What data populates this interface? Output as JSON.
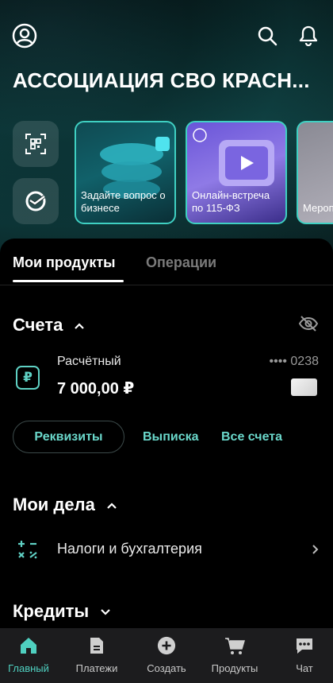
{
  "header": {
    "org_name": "АССОЦИАЦИЯ СВО КРАСН..."
  },
  "stories": [
    {
      "caption": "Задайте вопрос о бизнесе"
    },
    {
      "caption": "Онлайн-встреча по 115-ФЗ"
    },
    {
      "caption": "Мероп с эксп"
    }
  ],
  "tabs": {
    "products": "Мои продукты",
    "operations": "Операции"
  },
  "accounts": {
    "title": "Счета",
    "account_name": "Расчётный",
    "balance": "7 000,00 ₽",
    "masked_number": "•••• 0238",
    "buttons": {
      "details": "Реквизиты",
      "statement": "Выписка",
      "all": "Все счета"
    }
  },
  "tasks": {
    "title": "Мои дела",
    "item_label": "Налоги и бухгалтерия"
  },
  "credits": {
    "title": "Кредиты"
  },
  "tabbar": {
    "items": [
      {
        "label": "Главный",
        "icon": "home-icon",
        "active": true
      },
      {
        "label": "Платежи",
        "icon": "document-icon",
        "active": false
      },
      {
        "label": "Создать",
        "icon": "plus-circle-icon",
        "active": false
      },
      {
        "label": "Продукты",
        "icon": "cart-icon",
        "active": false
      },
      {
        "label": "Чат",
        "icon": "chat-icon",
        "active": false
      }
    ]
  },
  "colors": {
    "accent": "#4fd0c0",
    "background": "#000000",
    "tabbar": "#1c1c1e"
  }
}
